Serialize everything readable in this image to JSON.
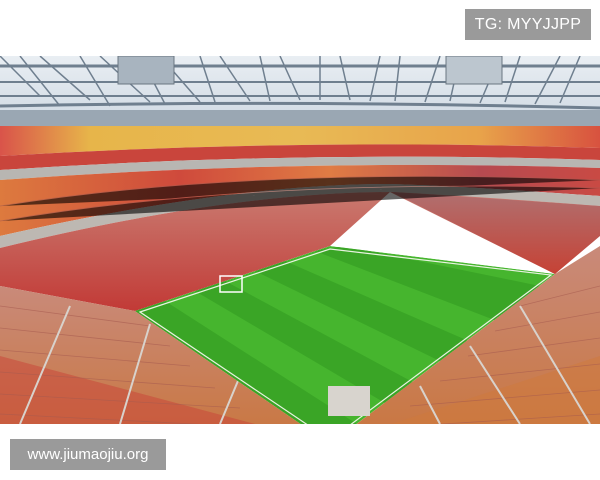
{
  "watermark_top": {
    "text": "TG: MYYJJPP"
  },
  "watermark_bottom": {
    "text": "www.jiumaojiu.org"
  },
  "colors": {
    "pitch_light": "#4fbf34",
    "pitch_dark": "#3aa526",
    "seat_red": "#c8473a",
    "seat_yellow": "#e0a43c",
    "roof_steel": "#7f8f9f",
    "sky": "#dfe8f0"
  }
}
